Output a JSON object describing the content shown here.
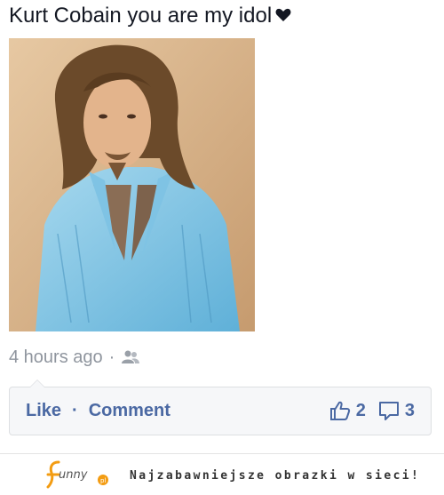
{
  "post": {
    "text": "Kurt Cobain you are my idol",
    "text_icon": "heart-icon",
    "photo_icon": "portrait-photo",
    "timestamp": "4 hours ago",
    "separator": "·",
    "audience_icon": "friends-icon"
  },
  "actions": {
    "like_label": "Like",
    "separator": "·",
    "comment_label": "Comment",
    "like_icon": "thumbs-up-icon",
    "like_count": "2",
    "comment_icon": "comment-bubble-icon",
    "comment_count": "3"
  },
  "footer": {
    "logo_text": "funny",
    "tagline": "Najzabawniejsze obrazki w sieci!"
  },
  "colors": {
    "link": "#4b69a3",
    "meta": "#8f959e",
    "action_bar_bg": "#f6f7f9",
    "logo_accent": "#f39c12"
  }
}
